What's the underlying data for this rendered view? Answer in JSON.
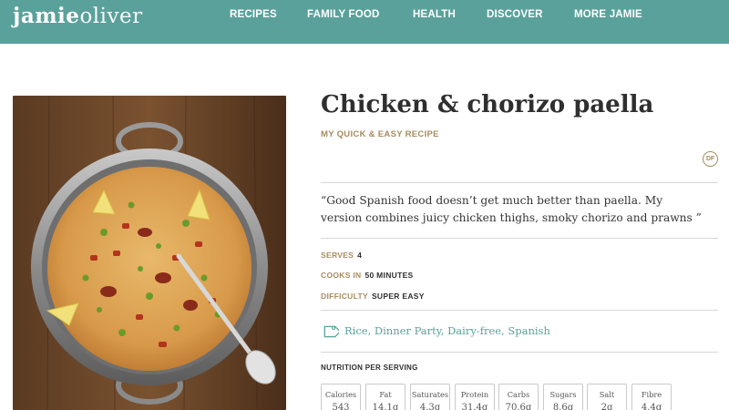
{
  "header": {
    "logo": {
      "part1": "jamie",
      "part2": "oliver"
    },
    "nav": [
      "RECIPES",
      "FAMILY FOOD",
      "HEALTH",
      "DISCOVER",
      "MORE JAMIE"
    ],
    "color": "#5aa19b"
  },
  "recipe": {
    "title": "Chicken & chorizo paella",
    "subtitle": "MY QUICK & EASY RECIPE",
    "badge": "DF",
    "quote": "“Good Spanish food doesn’t get much better than paella. My version combines juicy chicken thighs, smoky chorizo and prawns ”",
    "serves": {
      "label": "SERVES",
      "value": "4"
    },
    "cooks": {
      "label": "COOKS IN",
      "value": "50 MINUTES"
    },
    "difficulty": {
      "label": "DIFFICULTY",
      "value": "SUPER EASY"
    },
    "tags": [
      "Rice",
      "Dinner Party",
      "Dairy-free",
      "Spanish"
    ],
    "tag_separator": ", ",
    "tag_icon": "tag-icon"
  },
  "nutrition": {
    "title": "NUTRITION PER SERVING",
    "items": [
      {
        "label": "Calories",
        "value": "543"
      },
      {
        "label": "Fat",
        "value": "14.1g"
      },
      {
        "label": "Saturates",
        "value": "4.3g"
      },
      {
        "label": "Protein",
        "value": "31.4g"
      },
      {
        "label": "Carbs",
        "value": "70.6g"
      },
      {
        "label": "Sugars",
        "value": "8.6g"
      },
      {
        "label": "Salt",
        "value": "2g"
      },
      {
        "label": "Fibre",
        "value": "4.4g"
      }
    ]
  },
  "colors": {
    "accent": "#5aa19b",
    "gold": "#a78c5f"
  }
}
